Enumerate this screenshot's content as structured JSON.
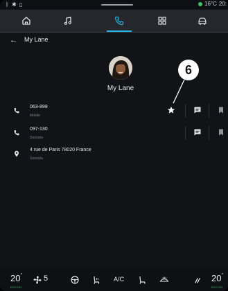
{
  "status_bar": {
    "left_icons": "ᛒ ✱ ▯",
    "temperature": "16°C",
    "time": "20:"
  },
  "nav": {
    "items": [
      {
        "icon": "home-icon",
        "active": false
      },
      {
        "icon": "music-note-icon",
        "active": false
      },
      {
        "icon": "phone-icon",
        "active": true
      },
      {
        "icon": "apps-grid-icon",
        "active": false
      },
      {
        "icon": "car-icon",
        "active": false
      }
    ]
  },
  "header": {
    "back": "←",
    "title": "My Lane"
  },
  "contact": {
    "name": "My Lane",
    "callout_number": "6"
  },
  "rows": [
    {
      "type": "phone",
      "value": "063-899",
      "label": "Mobile"
    },
    {
      "type": "phone",
      "value": "097-130",
      "label": "Domicile"
    },
    {
      "type": "address",
      "value": "4 rue de Paris 78020 France",
      "label": "Domicile"
    }
  ],
  "climate": {
    "left_temp": "20",
    "left_unit": "°",
    "left_eco": "ECO OO",
    "fan_level": "5",
    "ac_label": "A/C",
    "right_temp": "20",
    "right_unit": "°",
    "right_eco": "ECO OO"
  }
}
